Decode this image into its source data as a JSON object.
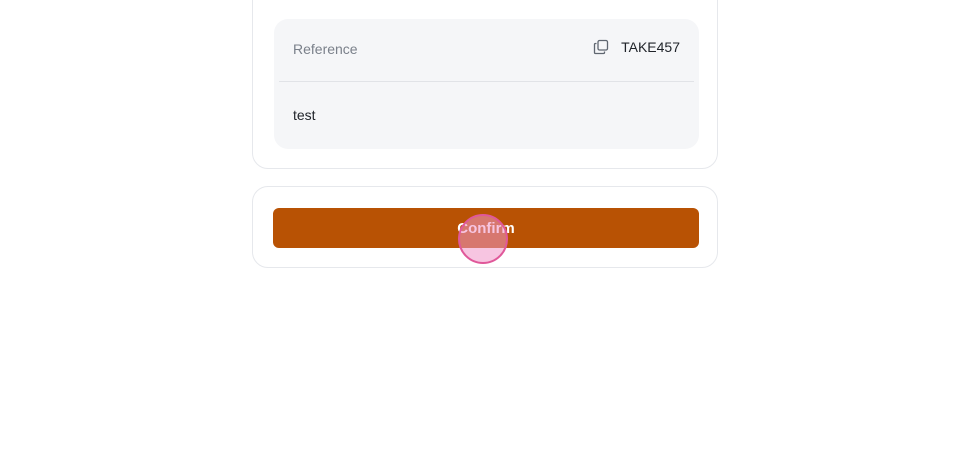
{
  "reference": {
    "label": "Reference",
    "value": "TAKE457",
    "copy_icon": "copy-icon"
  },
  "note": "test",
  "actions": {
    "confirm_label": "Confirm"
  },
  "colors": {
    "accent": "#b85204",
    "panel_bg": "#f5f6f8",
    "cursor": "#e0589a"
  }
}
